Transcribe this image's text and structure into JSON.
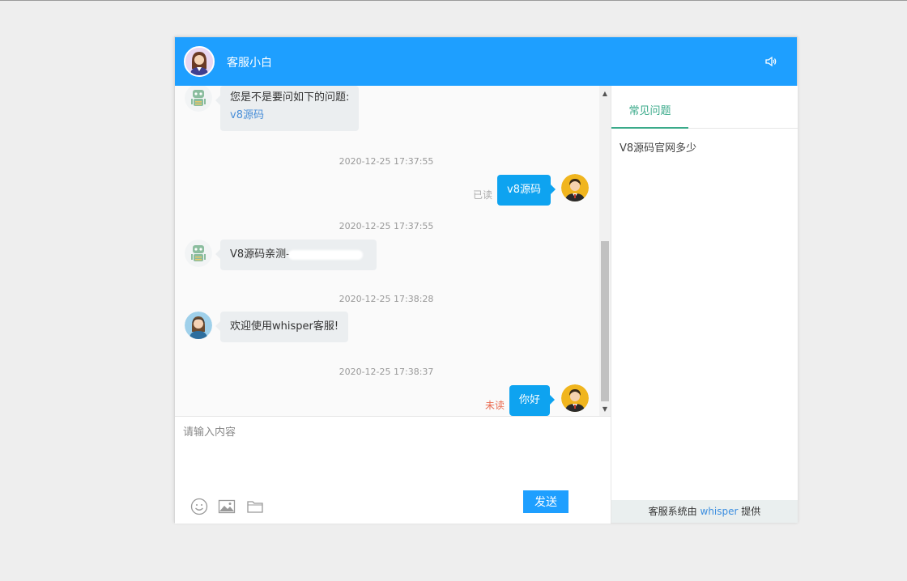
{
  "header": {
    "title": "客服小白"
  },
  "messages": [
    {
      "line1": "您是不是要问如下的问题:",
      "link": "v8源码"
    },
    {
      "time": "2020-12-25 17:37:55",
      "text": "v8源码",
      "status": "已读"
    },
    {
      "time": "2020-12-25 17:37:55",
      "text": "V8源码亲测-"
    },
    {
      "time": "2020-12-25 17:38:28",
      "text": "欢迎使用whisper客服!"
    },
    {
      "time": "2020-12-25 17:38:37",
      "text": "你好",
      "status": "未读"
    }
  ],
  "input": {
    "placeholder": "请输入内容",
    "send_label": "发送"
  },
  "side": {
    "tab_label": "常见问题",
    "faq": [
      "V8源码官网多少"
    ],
    "footer_prefix": "客服系统由",
    "footer_brand": "whisper",
    "footer_suffix": "提供"
  },
  "colors": {
    "primary": "#1e9fff",
    "bubble_right": "#0ea3f0",
    "read": "#aaaaaa",
    "unread": "#e96a4f",
    "tab_accent": "#3aaa8a"
  }
}
